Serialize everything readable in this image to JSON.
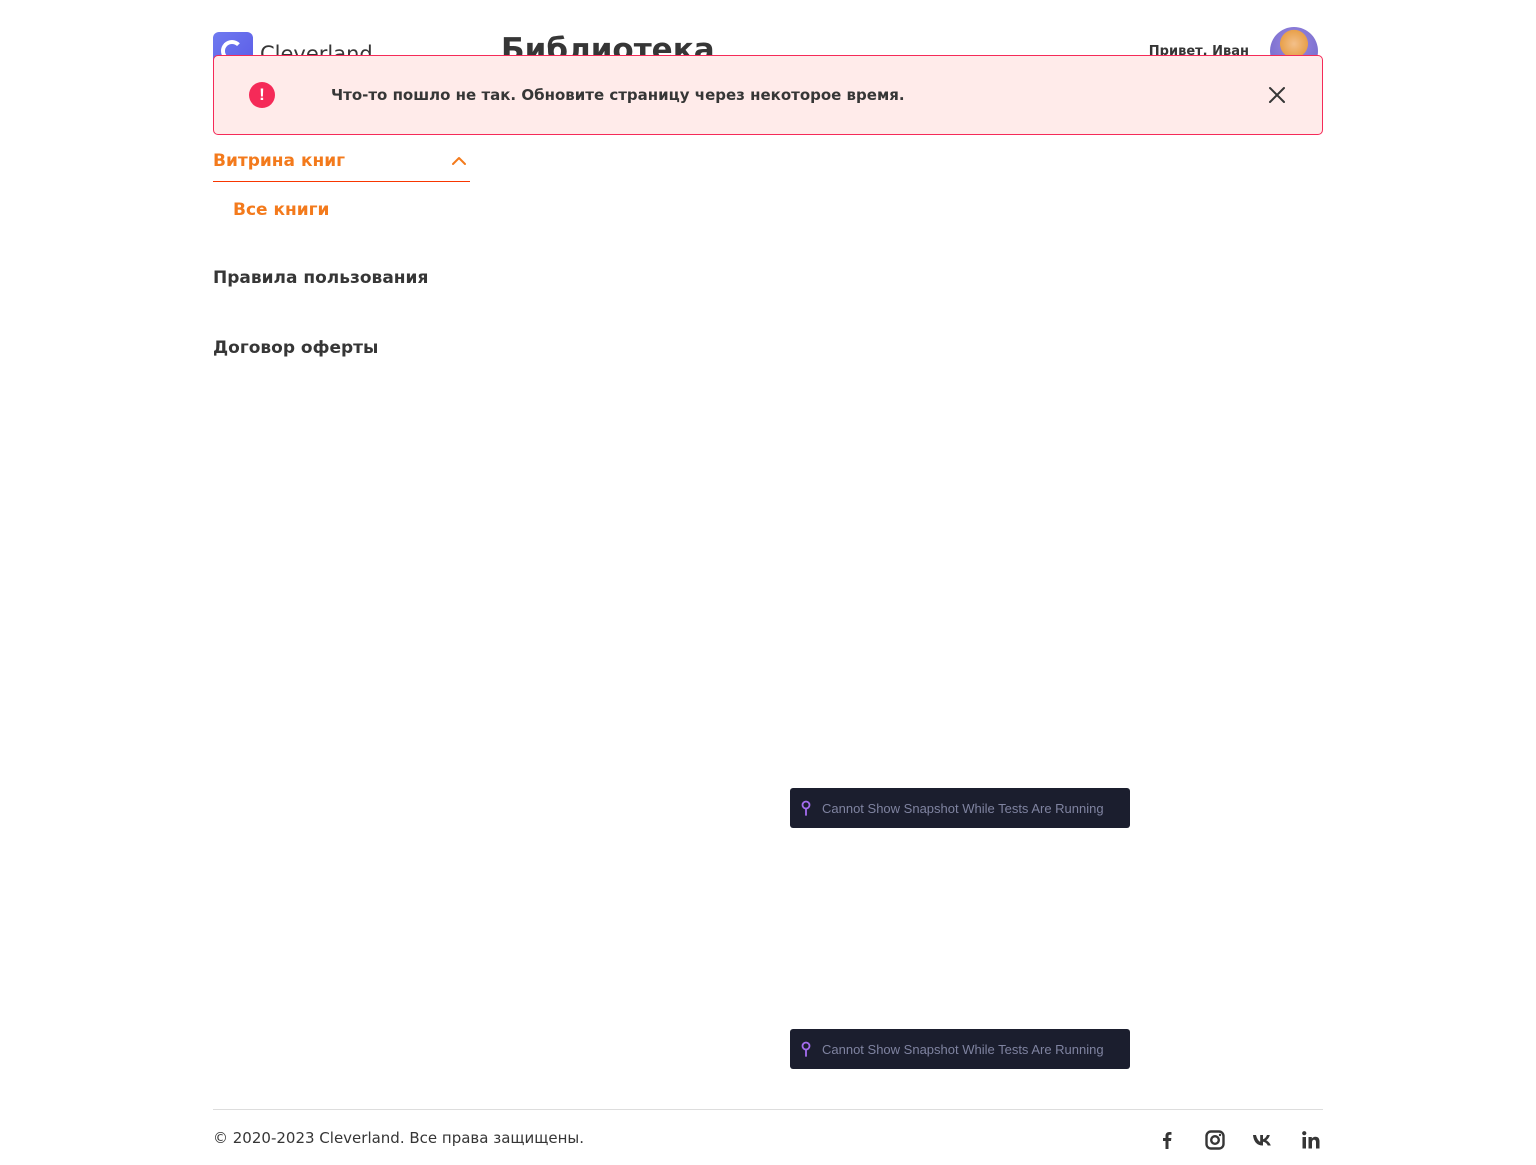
{
  "header": {
    "logo_text": "Cleverland",
    "title": "Библиотека",
    "greeting": "Привет, Иван"
  },
  "alert": {
    "icon_glyph": "!",
    "message": "Что-то пошло не так. Обновите страницу через некоторое время.",
    "color": "#f52a58",
    "background": "#ffebea"
  },
  "sidebar": {
    "section_label": "Витрина книг",
    "sub_items": [
      "Все книги"
    ],
    "links": [
      "Правила пользования",
      "Договор оферты"
    ],
    "accent_color": "#f37a1c"
  },
  "snapshots": [
    {
      "text": "Cannot Show Snapshot While Tests Are Running"
    },
    {
      "text": "Cannot Show Snapshot While Tests Are Running"
    }
  ],
  "footer": {
    "copyright": "© 2020-2023 Cleverland. Все права защищены.",
    "socials": [
      "facebook-icon",
      "instagram-icon",
      "vk-icon",
      "linkedin-icon"
    ]
  }
}
